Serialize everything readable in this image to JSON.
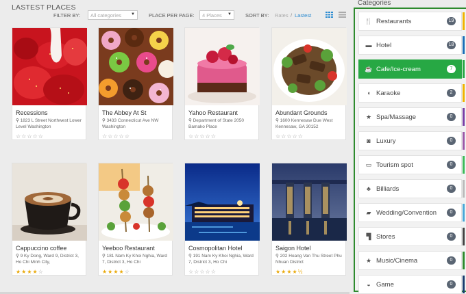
{
  "header": {
    "title": "LASTEST PLACES",
    "filter_label": "FILTER BY:",
    "filter_value": "All categories",
    "per_page_label": "PLACE PER PAGE:",
    "per_page_value": "4 Places",
    "sort_label": "SORT BY:",
    "sort_rates": "Rates",
    "sort_sep": "/",
    "sort_latest": "Lastest",
    "caret": "▼",
    "grid_view_icon": "grid-icon",
    "list_view_icon": "list-icon"
  },
  "places": [
    {
      "name": "Recessions",
      "address": "1823 L Street Northwest Lower Level Washington",
      "rating": 0,
      "photo": "strawberries"
    },
    {
      "name": "The Abbey At St",
      "address": "3433 Connecticut Ave NW Washington",
      "rating": 0,
      "photo": "donuts"
    },
    {
      "name": "Yahoo Restaurant",
      "address": "Department of State 2050 Bamako Place",
      "rating": 0,
      "photo": "cake"
    },
    {
      "name": "Abundant Grounds",
      "address": "1600 Kennesaw Due West Kennesaw, GA 30152",
      "rating": 0,
      "photo": "beef-salad"
    },
    {
      "name": "Cappuccino coffee",
      "address": "9 Ky Dong, Ward 9, District 3, Ho Chi Minh City,",
      "rating": 4,
      "photo": "coffee"
    },
    {
      "name": "Yeeboo Restaurant",
      "address": "181 Nam Ky Khoi Nghia, Ward 7, District 3, Ho Chi",
      "rating": 4,
      "photo": "skewers"
    },
    {
      "name": "Cosmopolitan Hotel",
      "address": "191 Nam Ky Khoi Nghia, Ward 7, District 3, Ho Chi",
      "rating": 0,
      "photo": "hotel-night"
    },
    {
      "name": "Saigon Hotel",
      "address": "202 Hoang Van Thu Street Phu Nhuan District",
      "rating": 4.5,
      "photo": "marina-bay"
    }
  ],
  "categories_title": "Categories",
  "categories": [
    {
      "label": "Restaurants",
      "count": "19",
      "icon": "cutlery-icon",
      "glyph": "🍴",
      "stripe": "#f0b400",
      "active": false
    },
    {
      "label": "Hotel",
      "count": "18",
      "icon": "bed-icon",
      "glyph": "▬",
      "stripe": "#1b6fb8",
      "active": false
    },
    {
      "label": "Cafe/Ice-cream",
      "count": "7",
      "icon": "coffee-icon",
      "glyph": "☕",
      "stripe": "#27a844",
      "active": true
    },
    {
      "label": "Karaoke",
      "count": "2",
      "icon": "mic-icon",
      "glyph": "◖",
      "stripe": "#f0b400",
      "active": false
    },
    {
      "label": "Spa/Massage",
      "count": "0",
      "icon": "star-icon",
      "glyph": "★",
      "stripe": "#7a3fa6",
      "active": false
    },
    {
      "label": "Luxury",
      "count": "0",
      "icon": "camera-icon",
      "glyph": "◙",
      "stripe": "#9b5aa8",
      "active": false
    },
    {
      "label": "Tourism spot",
      "count": "0",
      "icon": "car-icon",
      "glyph": "▭",
      "stripe": "#3dbb5a",
      "active": false
    },
    {
      "label": "Billiards",
      "count": "0",
      "icon": "tree-icon",
      "glyph": "♣",
      "stripe": "#bbbbbb",
      "active": false
    },
    {
      "label": "Wedding/Convention",
      "count": "0",
      "icon": "book-icon",
      "glyph": "▰",
      "stripe": "#4aa8d8",
      "active": false
    },
    {
      "label": "Stores",
      "count": "0",
      "icon": "cart-icon",
      "glyph": "▜",
      "stripe": "#444444",
      "active": false
    },
    {
      "label": "Music/Cinema",
      "count": "0",
      "icon": "star-icon",
      "glyph": "★",
      "stripe": "#2e8b2e",
      "active": false
    },
    {
      "label": "Game",
      "count": "0",
      "icon": "gamepad-icon",
      "glyph": "◒",
      "stripe": "#1b3e70",
      "active": false
    }
  ]
}
